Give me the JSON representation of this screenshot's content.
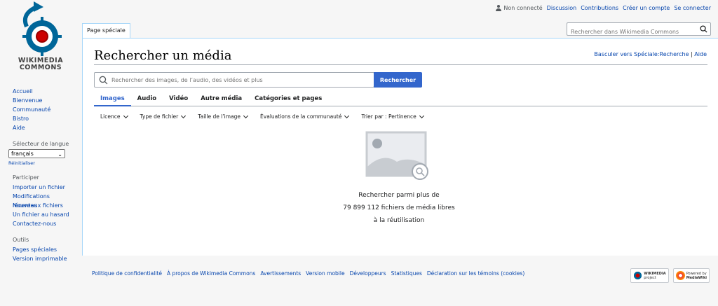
{
  "logo": {
    "line1": "WIKIMEDIA",
    "line2": "COMMONS"
  },
  "personal": {
    "not_logged_in": "Non connecté",
    "discussion": "Discussion",
    "contributions": "Contributions",
    "create_account": "Créer un compte",
    "login": "Se connecter"
  },
  "sidebar": {
    "nav": [
      "Accueil",
      "Bienvenue",
      "Communauté",
      "Bistro",
      "Aide"
    ],
    "language_heading": "Sélecteur de langue",
    "language_value": "français",
    "reset": "Réinitialiser",
    "participate_heading": "Participer",
    "participate": [
      "Importer un fichier",
      "Modifications récentes",
      "Nouveaux fichiers",
      "Un fichier au hasard",
      "Contactez-nous"
    ],
    "tools_heading": "Outils",
    "tools": [
      "Pages spéciales",
      "Version imprimable"
    ]
  },
  "tab": {
    "label": "Page spéciale"
  },
  "header_search": {
    "placeholder": "Rechercher dans Wikimedia Commons"
  },
  "main": {
    "title": "Rechercher un média",
    "switch_link": "Basculer vers Spéciale:Recherche",
    "separator": " | ",
    "help_link": "Aide",
    "search_placeholder": "Rechercher des images, de l’audio, des vidéos et plus",
    "search_button": "Rechercher",
    "tabs": [
      "Images",
      "Audio",
      "Vidéo",
      "Autre média",
      "Catégories et pages"
    ],
    "filters": [
      "Licence",
      "Type de fichier",
      "Taille de l’image",
      "Évaluations de la communauté",
      "Trier par : Pertinence"
    ],
    "empty_lines": [
      "Rechercher parmi plus de",
      "79 899 112 fichiers de média libres",
      "à la réutilisation"
    ]
  },
  "footer": {
    "links": [
      "Politique de confidentialité",
      "À propos de Wikimedia Commons",
      "Avertissements",
      "Version mobile",
      "Développeurs",
      "Statistiques",
      "Déclaration sur les témoins (cookies)"
    ],
    "badge_wikimedia_line1": "WIKIMEDIA",
    "badge_wikimedia_line2": "project",
    "badge_mediawiki_line1": "Powered by",
    "badge_mediawiki_line2": "MediaWiki"
  },
  "colors": {
    "accent": "#3366cc",
    "link": "#0645ad",
    "border": "#a7d7f9",
    "background": "#f6f6f6"
  }
}
